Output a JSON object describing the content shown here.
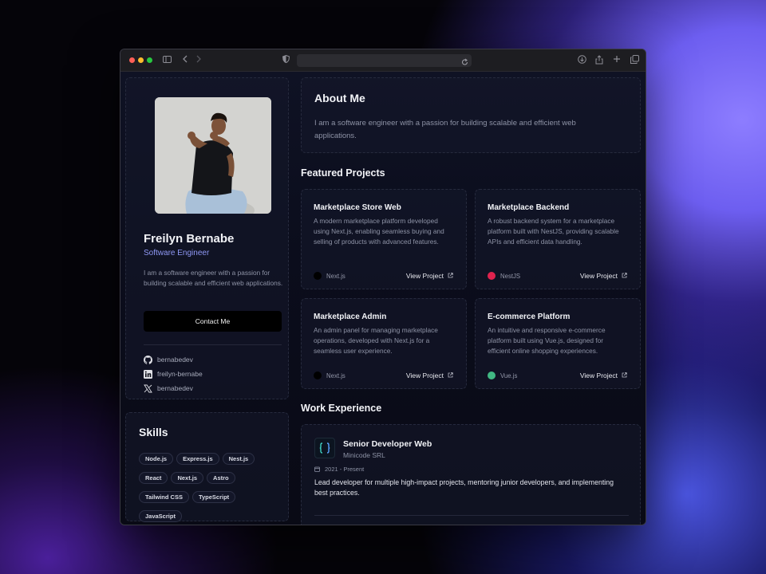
{
  "browser": {
    "url": "",
    "colors": {
      "close": "#ff5f57",
      "minimize": "#febc2e",
      "zoom": "#28c840"
    }
  },
  "profile": {
    "name": "Freilyn Bernabe",
    "role": "Software Engineer",
    "bio": "I am a software engineer with a passion for building scalable and efficient web applications.",
    "contact_label": "Contact Me",
    "social": [
      {
        "icon": "github-icon",
        "handle": "bernabedev"
      },
      {
        "icon": "linkedin-icon",
        "handle": "freilyn-bernabe"
      },
      {
        "icon": "x-icon",
        "handle": "bernabedev"
      }
    ]
  },
  "skills": {
    "title": "Skills",
    "items": [
      "Node.js",
      "Express.js",
      "Nest.js",
      "React",
      "Next.js",
      "Astro",
      "Tailwind CSS",
      "TypeScript",
      "JavaScript"
    ]
  },
  "about": {
    "title": "About Me",
    "text": "I am a software engineer with a passion for building scalable and efficient web applications."
  },
  "projects": {
    "title": "Featured Projects",
    "link_label": "View Project",
    "items": [
      {
        "title": "Marketplace Store Web",
        "description": "A modern marketplace platform developed using Next.js, enabling seamless buying and selling of products with advanced features.",
        "tech": "Next.js",
        "tech_color": "#000000"
      },
      {
        "title": "Marketplace Backend",
        "description": "A robust backend system for a marketplace platform built with NestJS, providing scalable APIs and efficient data handling.",
        "tech": "NestJS",
        "tech_color": "#e0234e"
      },
      {
        "title": "Marketplace Admin",
        "description": "An admin panel for managing marketplace operations, developed with Next.js for a seamless user experience.",
        "tech": "Next.js",
        "tech_color": "#000000"
      },
      {
        "title": "E-commerce Platform",
        "description": "An intuitive and responsive e-commerce platform built using Vue.js, designed for efficient online shopping experiences.",
        "tech": "Vue.js",
        "tech_color": "#41b883"
      }
    ]
  },
  "experience": {
    "title": "Work Experience",
    "items": [
      {
        "role": "Senior Developer Web",
        "company": "Minicode SRL",
        "period": "2021 - Present",
        "description": "Lead developer for multiple high-impact projects, mentoring junior developers, and implementing best practices."
      }
    ]
  }
}
